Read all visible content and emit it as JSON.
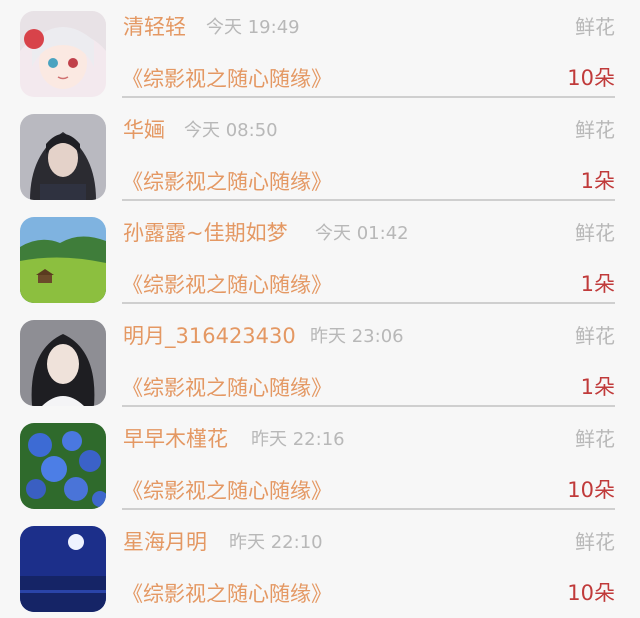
{
  "list": {
    "items": [
      {
        "name": "清轻轻",
        "time": "今天 19:49",
        "gift": "鲜花",
        "book": "《综影视之随心随缘》",
        "count": "10朵"
      },
      {
        "name": "华婳",
        "time": "今天 08:50",
        "gift": "鲜花",
        "book": "《综影视之随心随缘》",
        "count": "1朵"
      },
      {
        "name": "孙露露~佳期如梦",
        "time": "今天 01:42",
        "gift": "鲜花",
        "book": "《综影视之随心随缘》",
        "count": "1朵"
      },
      {
        "name": "明月_316423430",
        "time": "昨天 23:06",
        "gift": "鲜花",
        "book": "《综影视之随心随缘》",
        "count": "1朵"
      },
      {
        "name": "早早木槿花",
        "time": "昨天 22:16",
        "gift": "鲜花",
        "book": "《综影视之随心随缘》",
        "count": "10朵"
      },
      {
        "name": "星海月明",
        "time": "昨天 22:10",
        "gift": "鲜花",
        "book": "《综影视之随心随缘》",
        "count": "10朵"
      }
    ]
  },
  "colors": {
    "name": "#e49863",
    "meta": "#b8b8b8",
    "count": "#c03a3a",
    "background": "#f7f7f7"
  }
}
